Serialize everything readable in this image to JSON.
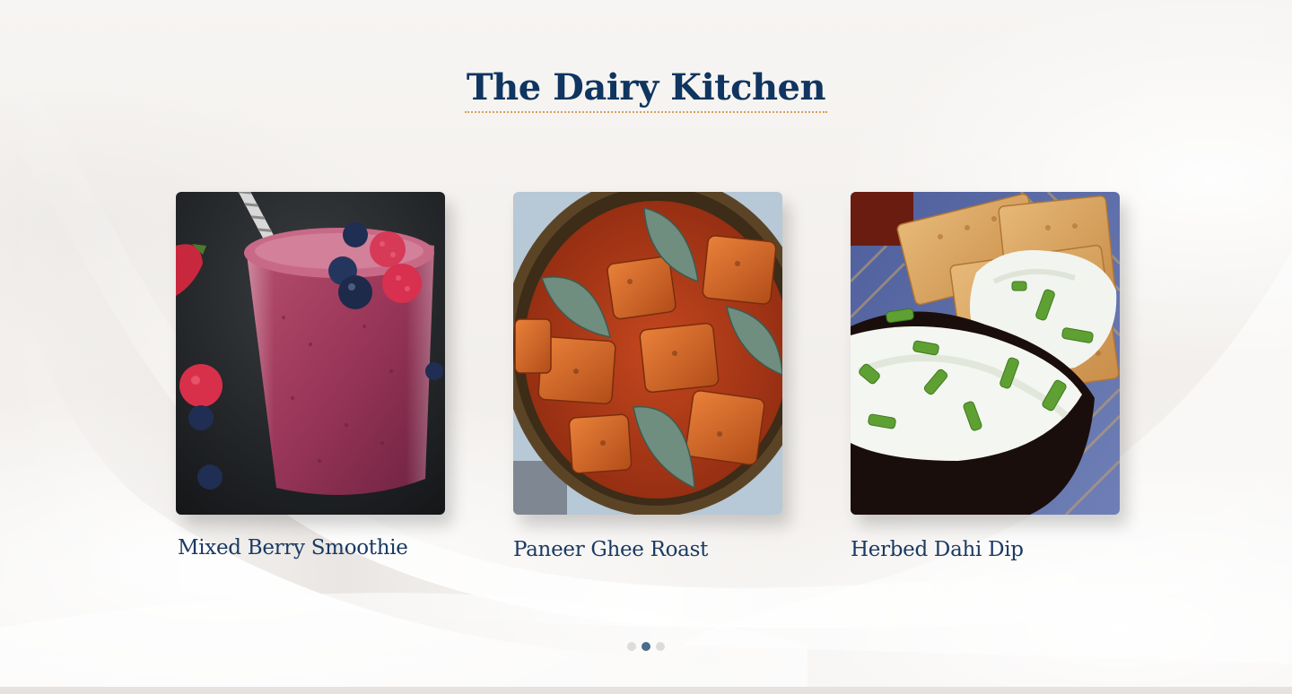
{
  "section": {
    "title": "The Dairy Kitchen"
  },
  "recipes": [
    {
      "name": "Mixed Berry Smoothie",
      "image_icon": "berry-smoothie-photo"
    },
    {
      "name": "Paneer Ghee Roast",
      "image_icon": "paneer-ghee-roast-photo"
    },
    {
      "name": "Herbed Dahi Dip",
      "image_icon": "herbed-dahi-dip-photo"
    }
  ],
  "carousel": {
    "page_count": 3,
    "active_page": 2
  },
  "colors": {
    "title": "#0f3560",
    "recipe_name": "#1a3a62",
    "title_underline": "#d3a15b",
    "dot_active": "#4a6b8a",
    "dot_inactive": "#dcdcdc"
  }
}
